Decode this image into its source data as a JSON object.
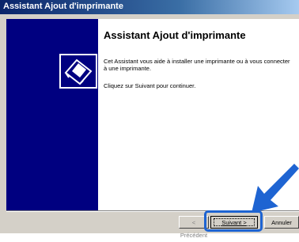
{
  "window": {
    "title": "Assistant Ajout d'imprimante"
  },
  "wizard": {
    "heading": "Assistant Ajout d'imprimante",
    "description": "Cet Assistant vous aide à installer une imprimante ou à vous connecter à une imprimante.",
    "instruction": "Cliquez sur Suivant pour continuer."
  },
  "buttons": {
    "back": "< Précédent",
    "next": "Suivant >",
    "cancel": "Annuler"
  },
  "colors": {
    "side_panel": "#000080",
    "highlight": "#1e64d2",
    "arrow": "#1e64d2"
  }
}
